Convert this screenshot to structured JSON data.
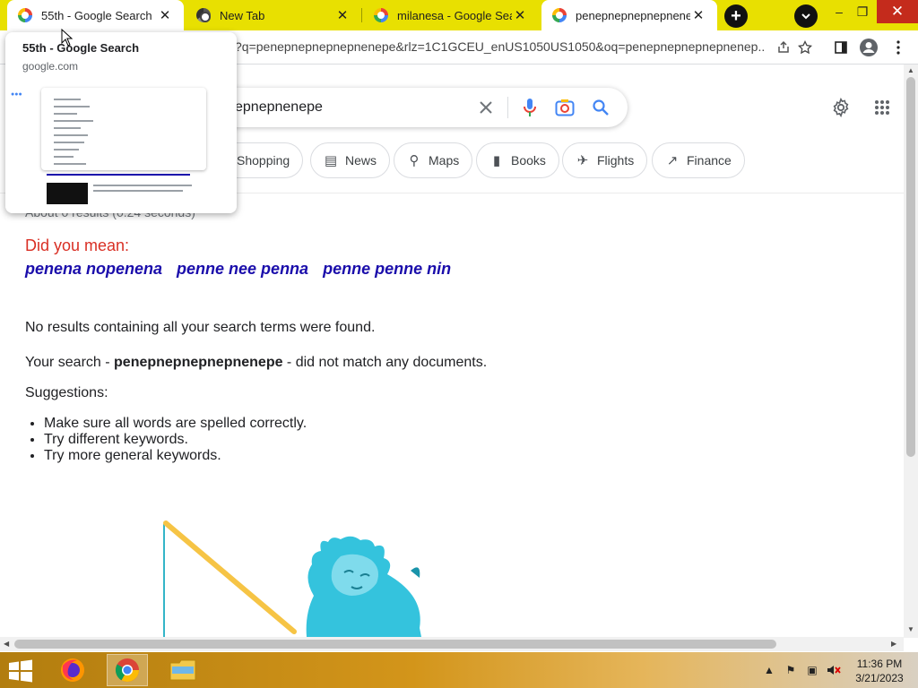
{
  "browser": {
    "tabs": [
      {
        "title": "55th - Google Search",
        "favicon": "google-icon"
      },
      {
        "title": "New Tab",
        "favicon": "chrome-icon"
      },
      {
        "title": "milanesa - Google Search",
        "favicon": "google-icon"
      },
      {
        "title": "penepnepnepnepnenepe",
        "favicon": "google-icon"
      }
    ],
    "new_tab_label": "+",
    "address_text": "?q=penepnepnepnepnenepe&rlz=1C1GCEU_enUS1050US1050&oq=penepnepnepnepnenep...",
    "window_controls": {
      "minimize": "–",
      "maximize": "❐",
      "close": "✕"
    }
  },
  "tab_preview": {
    "title": "55th - Google Search",
    "domain": "google.com"
  },
  "search": {
    "query_visible": "epnepnenepe",
    "chips": [
      {
        "label": "Shopping",
        "icon": "shopping-tag-icon"
      },
      {
        "label": "News",
        "icon": "news-icon"
      },
      {
        "label": "Maps",
        "icon": "map-pin-icon"
      },
      {
        "label": "Books",
        "icon": "book-icon"
      },
      {
        "label": "Flights",
        "icon": "airplane-icon"
      },
      {
        "label": "Finance",
        "icon": "finance-chart-icon"
      }
    ],
    "result_stats": "About 0 results (0.24 seconds)"
  },
  "results": {
    "did_you_mean": "Did you mean:",
    "suggestions": [
      "penena nopenena",
      "penne nee penna",
      "penne penne nin"
    ],
    "no_results": "No results containing all your search terms were found.",
    "your_search_prefix": "Your search - ",
    "your_search_term": "penepnepnepnepnenepe",
    "your_search_suffix": " - did not match any documents.",
    "suggestions_heading": "Suggestions:",
    "tips": [
      "Make sure all words are spelled correctly.",
      "Try different keywords.",
      "Try more general keywords."
    ]
  },
  "taskbar": {
    "apps": [
      "windows-start",
      "firefox",
      "chrome",
      "file-explorer"
    ],
    "clock_time": "11:36 PM",
    "clock_date": "3/21/2023"
  },
  "colors": {
    "tabstrip": "#e8e001",
    "link": "#1a0dab",
    "did_you_mean": "#d93025",
    "close_button": "#c42b1c"
  }
}
